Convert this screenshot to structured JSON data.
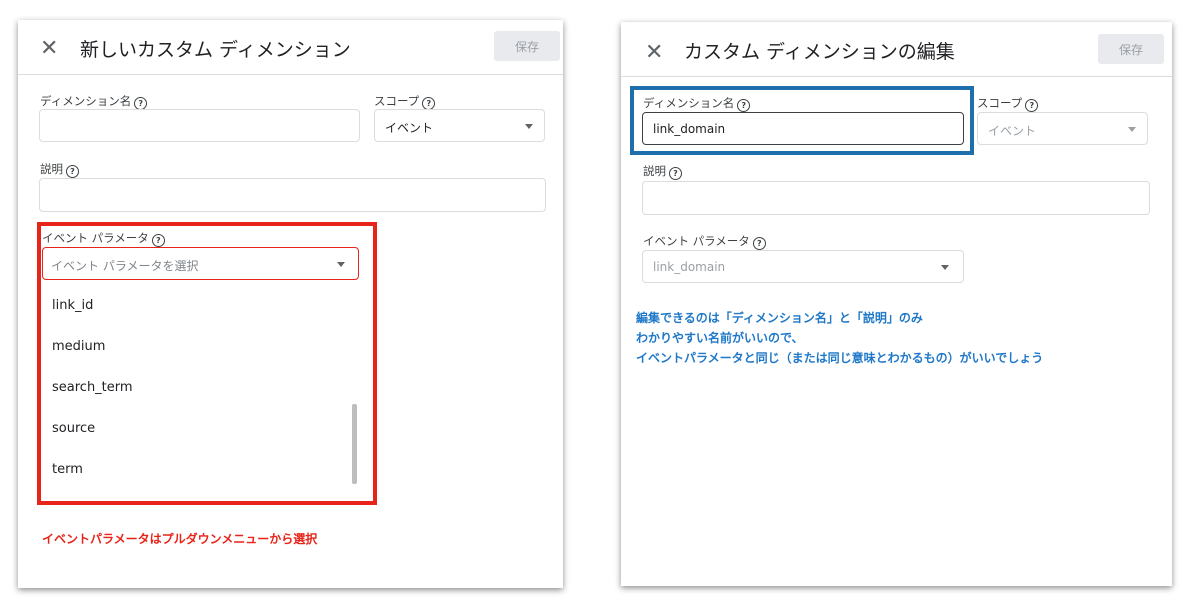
{
  "left": {
    "close_icon": "✕",
    "title": "新しいカスタム ディメンション",
    "save_label": "保存",
    "dimension_name_label": "ディメンション名",
    "dimension_name_value": "",
    "scope_label": "スコープ",
    "scope_value": "イベント",
    "description_label": "説明",
    "description_value": "",
    "event_param_label": "イベント パラメータ",
    "event_param_placeholder": "イベント パラメータを選択",
    "dropdown_options": [
      "link_id",
      "medium",
      "search_term",
      "source",
      "term"
    ],
    "annotation": "イベントパラメータはプルダウンメニューから選択"
  },
  "right": {
    "close_icon": "✕",
    "title": "カスタム ディメンションの編集",
    "save_label": "保存",
    "dimension_name_label": "ディメンション名",
    "dimension_name_value": "link_domain",
    "scope_label": "スコープ",
    "scope_value": "イベント",
    "description_label": "説明",
    "description_value": "",
    "event_param_label": "イベント パラメータ",
    "event_param_value": "link_domain",
    "annotation_lines": [
      "編集できるのは「ディメンション名」と「説明」のみ",
      "わかりやすい名前がいいので、",
      "イベントパラメータと同じ（または同じ意味とわかるもの）がいいでしょう"
    ]
  },
  "colors": {
    "highlight_red": "#e8231a",
    "highlight_blue": "#1f6fad",
    "annotation_red": "#e8231a",
    "annotation_blue": "#1f78c8"
  },
  "icons": {
    "help": "help-circle-icon",
    "close": "close-icon",
    "dropdown": "dropdown-arrow-icon"
  }
}
